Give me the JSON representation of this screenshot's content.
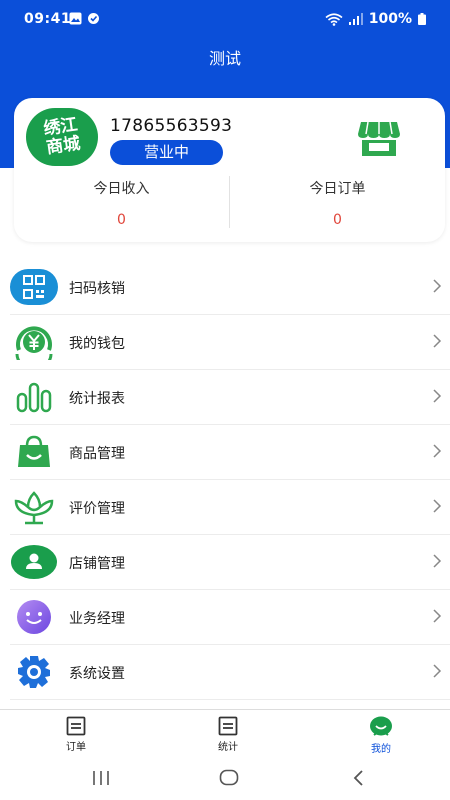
{
  "status_bar": {
    "time": "09:41",
    "battery": "100%"
  },
  "header": {
    "title": "测试"
  },
  "profile": {
    "logo_text_line1": "绣江",
    "logo_text_line2": "商城",
    "phone": "17865563593",
    "status": "营业中"
  },
  "stats": [
    {
      "label": "今日收入",
      "value": "0"
    },
    {
      "label": "今日订单",
      "value": "0"
    }
  ],
  "menu": [
    {
      "label": "扫码核销",
      "icon": "qr-scan-icon"
    },
    {
      "label": "我的钱包",
      "icon": "yuan-wallet-icon"
    },
    {
      "label": "统计报表",
      "icon": "bar-chart-icon"
    },
    {
      "label": "商品管理",
      "icon": "shopping-bag-icon"
    },
    {
      "label": "评价管理",
      "icon": "flower-icon"
    },
    {
      "label": "店铺管理",
      "icon": "user-shop-icon"
    },
    {
      "label": "业务经理",
      "icon": "smiley-icon"
    },
    {
      "label": "系统设置",
      "icon": "gear-icon"
    }
  ],
  "bottom_nav": [
    {
      "label": "订单",
      "icon": "orders-icon"
    },
    {
      "label": "统计",
      "icon": "stats-icon"
    },
    {
      "label": "我的",
      "icon": "mine-icon",
      "active": true
    }
  ],
  "colors": {
    "primary": "#0b4fd9",
    "green": "#1a9e4c",
    "value_red": "#e0453a"
  }
}
